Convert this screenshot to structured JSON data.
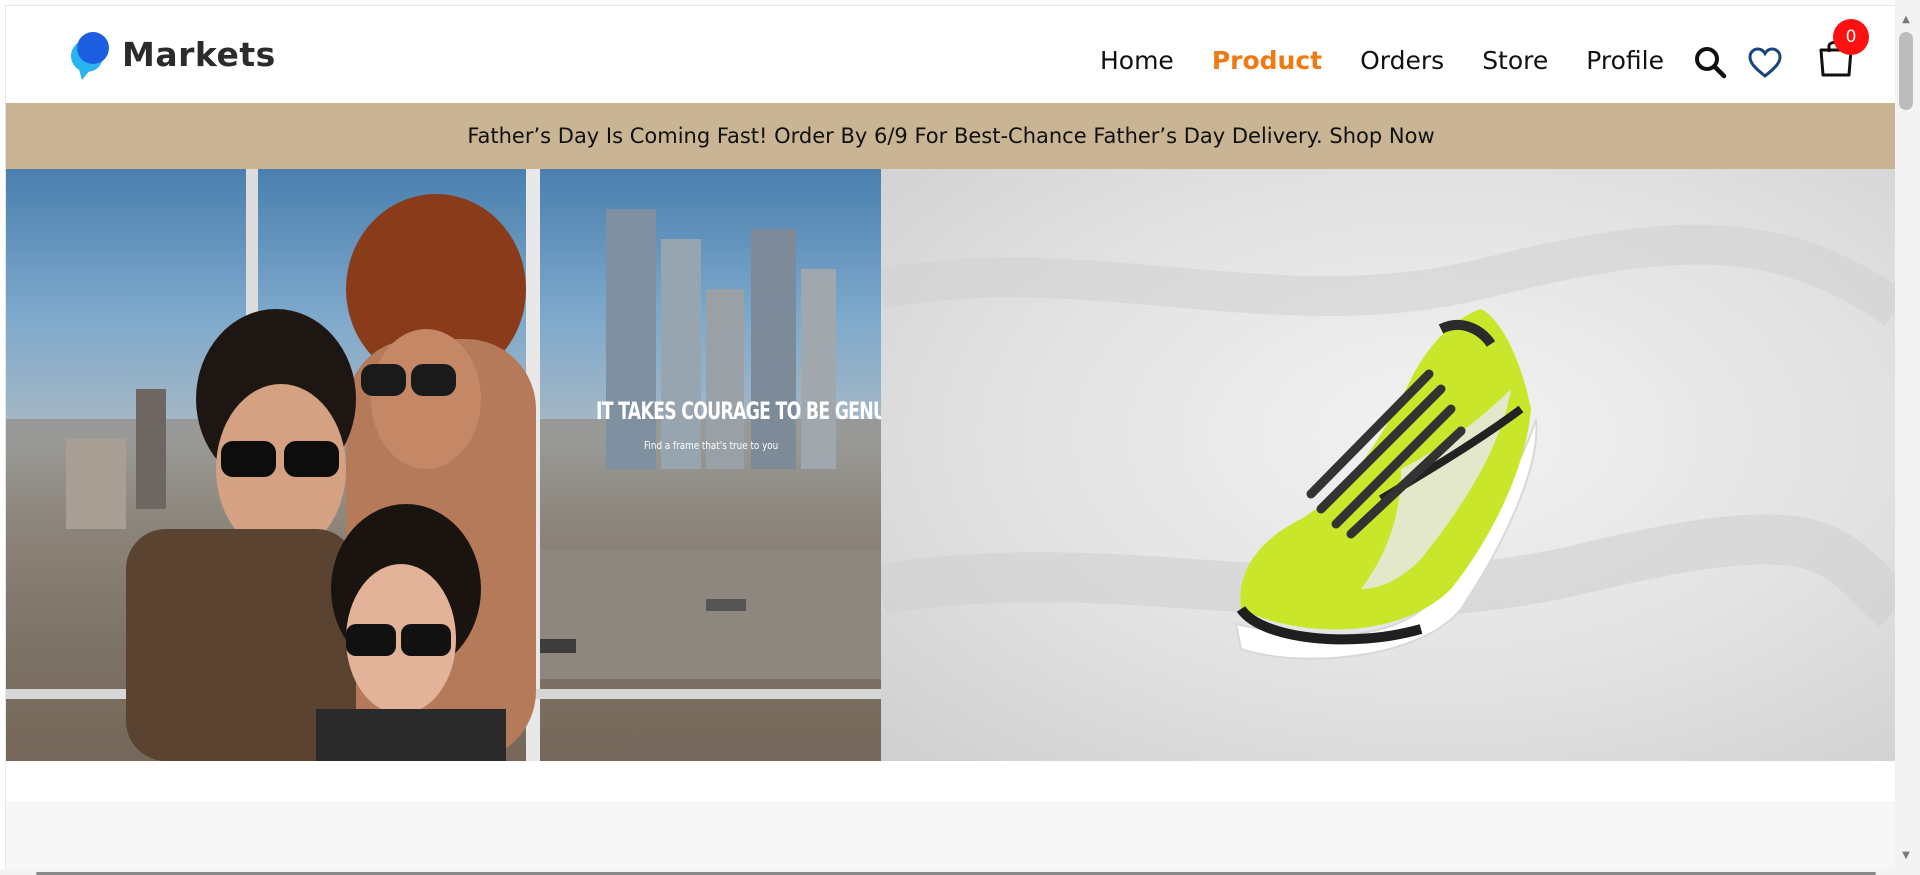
{
  "brand": {
    "name": "Markets"
  },
  "nav": {
    "items": [
      {
        "label": "Home",
        "active": false
      },
      {
        "label": "Product",
        "active": true
      },
      {
        "label": "Orders",
        "active": false
      },
      {
        "label": "Store",
        "active": false
      },
      {
        "label": "Profile",
        "active": false
      }
    ],
    "active_color": "#f07a10"
  },
  "header_icons": [
    "search-icon",
    "heart-icon",
    "cart-icon"
  ],
  "cart": {
    "count": "0",
    "badge_color": "#ff1111"
  },
  "promo": {
    "text": "Father’s Day Is Coming Fast! Order By 6/9 For Best-Chance Father’s Day Delivery. Shop Now",
    "background": "#c9b494"
  },
  "hero": {
    "left": {
      "headline": "IT TAKES COURAGE TO BE GENUINE",
      "subline": "Find a frame that's true to you"
    },
    "right": {
      "product": "neon-yellow running shoe"
    }
  }
}
